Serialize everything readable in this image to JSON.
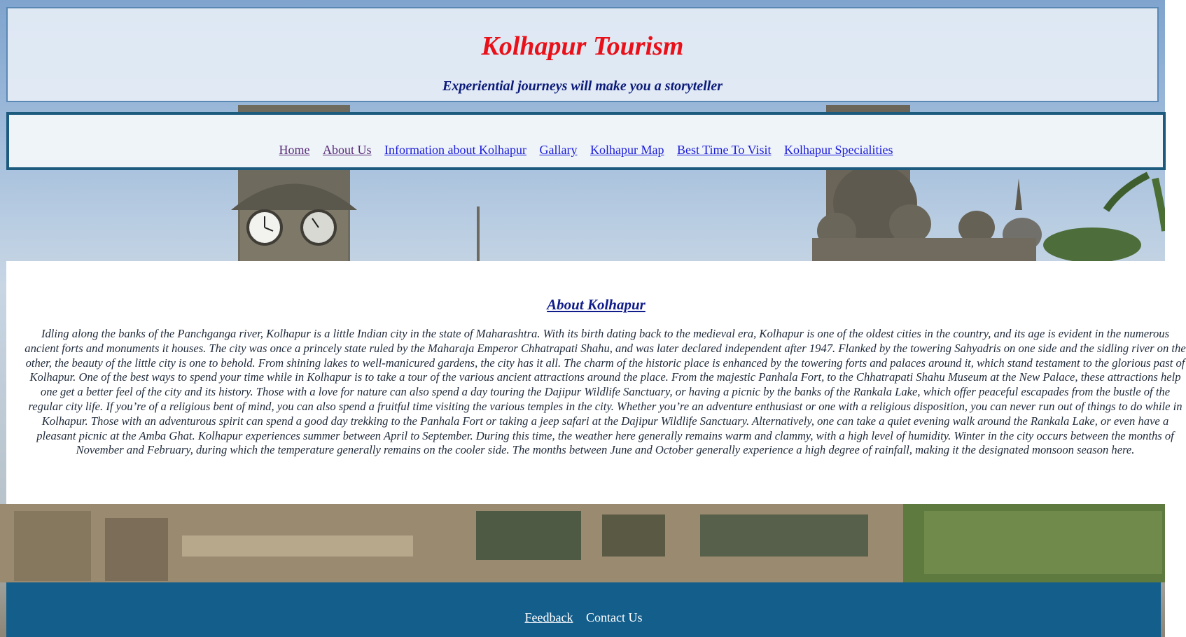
{
  "header": {
    "title": "Kolhapur Tourism",
    "tagline": "Experiential journeys will make you a storyteller"
  },
  "nav": {
    "items": [
      {
        "label": "Home"
      },
      {
        "label": "About Us"
      },
      {
        "label": "Information about Kolhapur"
      },
      {
        "label": "Gallary"
      },
      {
        "label": "Kolhapur Map"
      },
      {
        "label": "Best Time To Visit"
      },
      {
        "label": "Kolhapur Specialities"
      }
    ]
  },
  "main": {
    "heading": "About Kolhapur",
    "paragraph": "Idling along the banks of the Panchganga river, Kolhapur is a little Indian city in the state of Maharashtra. With its birth dating back to the medieval era, Kolhapur is one of the oldest cities in the country, and its age is evident in the numerous ancient forts and monuments it houses. The city was once a princely state ruled by the Maharaja Emperor Chhatrapati Shahu, and was later declared independent after 1947. Flanked by the towering Sahyadris on one side and the sidling river on the other, the beauty of the little city is one to behold. From shining lakes to well-manicured gardens, the city has it all. The charm of the historic place is enhanced by the towering forts and palaces around it, which stand testament to the glorious past of Kolhapur. One of the best ways to spend your time while in Kolhapur is to take a tour of the various ancient attractions around the place. From the majestic Panhala Fort, to the Chhatrapati Shahu Museum at the New Palace, these attractions help one get a better feel of the city and its history. Those with a love for nature can also spend a day touring the Dajipur Wildlife Sanctuary, or having a picnic by the banks of the Rankala Lake, which offer peaceful escapades from the bustle of the regular city life. If you’re of a religious bent of mind, you can also spend a fruitful time visiting the various temples in the city. Whether you’re an adventure enthusiast or one with a religious disposition, you can never run out of things to do while in Kolhapur. Those with an adventurous spirit can spend a good day trekking to the Panhala Fort or taking a jeep safari at the Dajipur Wildlife Sanctuary. Alternatively, one can take a quiet evening walk around the Rankala Lake, or even have a pleasant picnic at the Amba Ghat. Kolhapur experiences summer between April to September. During this time, the weather here generally remains warm and clammy, with a high level of humidity. Winter in the city occurs between the months of November and February, during which the temperature generally remains on the cooler side. The months between June and October generally experience a high degree of rainfall, making it the designated monsoon season here."
  },
  "footer": {
    "items": [
      {
        "label": "Feedback"
      },
      {
        "label": "Contact Us"
      }
    ]
  },
  "colors": {
    "title": "#e8111a",
    "tagline": "#0b1a7a",
    "nav_border": "#1c5a7e",
    "footer_bg": "#145e8c"
  }
}
